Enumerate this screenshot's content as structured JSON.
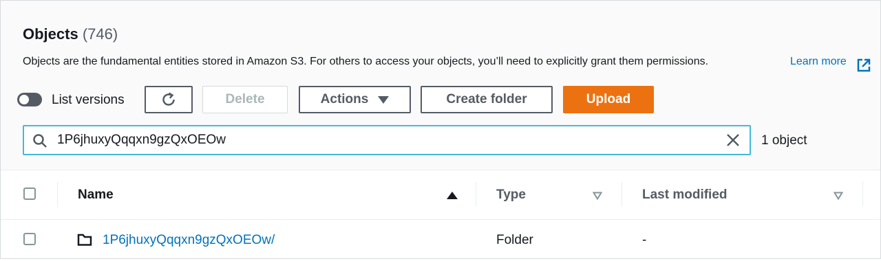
{
  "header": {
    "title": "Objects",
    "count": "(746)",
    "description": "Objects are the fundamental entities stored in Amazon S3. For others to access your objects, you’ll need to explicitly grant them permissions.",
    "learn_more": "Learn more"
  },
  "toolbar": {
    "list_versions_label": "List versions",
    "list_versions_on": false,
    "delete_label": "Delete",
    "actions_label": "Actions",
    "create_folder_label": "Create folder",
    "upload_label": "Upload"
  },
  "search": {
    "value": "1P6jhuxyQqqxn9gzQxOEOw",
    "result_count": "1 object"
  },
  "table": {
    "columns": [
      "Name",
      "Type",
      "Last modified"
    ],
    "rows": [
      {
        "name": "1P6jhuxyQqqxn9gzQxOEOw/",
        "type": "Folder",
        "last_modified": "-"
      }
    ]
  },
  "colors": {
    "accent": "#ec7211",
    "link": "#0073bb",
    "focus": "#44b9d6"
  }
}
